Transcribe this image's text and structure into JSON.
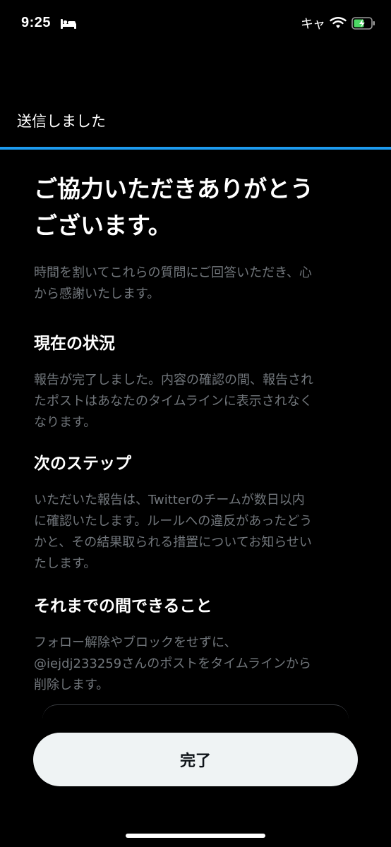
{
  "status_bar": {
    "time": "9:25",
    "carrier": "キャ",
    "battery_icon": "battery-icon",
    "wifi_icon": "wifi-icon"
  },
  "header": {
    "title": "送信しました"
  },
  "colors": {
    "accent": "#1d9bf0",
    "background": "#000000",
    "muted_text": "#71767b",
    "button_bg": "#eff3f4"
  },
  "main": {
    "title_line1": "ご協力いただきありがとう",
    "title_line2": "ございます。",
    "subtitle_line1": "時間を割いてこれらの質問にご回答いただき、心",
    "subtitle_line2": "から感謝いたします。",
    "sections": [
      {
        "heading": "現在の状況",
        "lines": [
          "報告が完了しました。内容の確認の間、報告され",
          "たポストはあなたのタイムラインに表示されなく",
          "なります。"
        ]
      },
      {
        "heading": "次のステップ",
        "lines": [
          "いただいた報告は、Twitterのチームが数日以内",
          "に確認いたします。ルールへの違反があったどう",
          "かと、その結果取られる措置についてお知らせい",
          "たします。"
        ]
      },
      {
        "heading": "それまでの間できること",
        "lines": [
          "フォロー解除やブロックをせずに、",
          "@iejdj233259さんのポストをタイムラインから",
          "削除します。"
        ]
      }
    ]
  },
  "footer": {
    "done_label": "完了"
  }
}
